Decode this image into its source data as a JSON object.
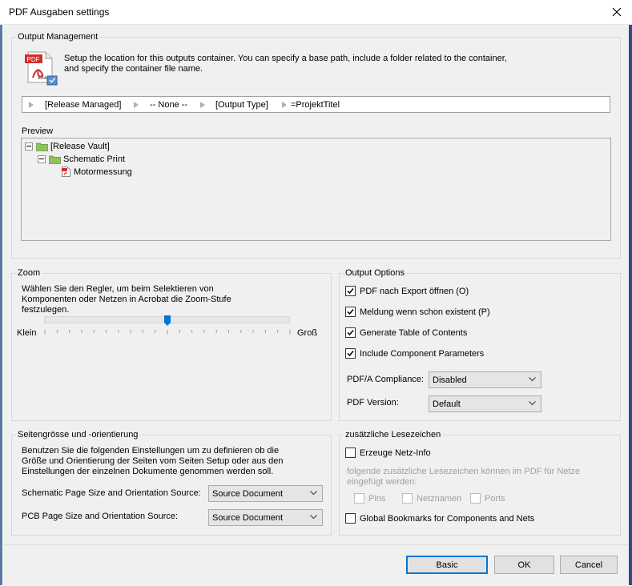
{
  "window": {
    "title": "PDF Ausgaben settings"
  },
  "output_management": {
    "title": "Output Management",
    "description_line1": "Setup the location for this outputs container. You can specify a base path, include a folder related to the container,",
    "description_line2": "and specify the container file name.",
    "path_segments": [
      "[Release Managed]",
      "-- None --",
      "[Output Type]",
      "=ProjektTitel"
    ],
    "preview_label": "Preview",
    "tree": [
      {
        "label": "[Release Vault]"
      },
      {
        "label": "Schematic Print"
      },
      {
        "label": "Motormessung"
      }
    ]
  },
  "zoom": {
    "title": "Zoom",
    "description_line1": "Wählen Sie den Regler, um beim Selektieren von",
    "description_line2": "Komponenten oder Netzen in Acrobat die Zoom-Stufe",
    "description_line3": "festzulegen.",
    "min_label": "Klein",
    "max_label": "Groß",
    "slider_fraction": 0.5
  },
  "output_options": {
    "title": "Output Options",
    "checkboxes": [
      {
        "label": "PDF nach Export öffnen (O)",
        "checked": true
      },
      {
        "label": "Meldung wenn schon existent (P)",
        "checked": true
      },
      {
        "label": "Generate Table of Contents",
        "checked": true
      },
      {
        "label": "Include Component Parameters",
        "checked": true
      }
    ],
    "pdfa_label": "PDF/A Compliance:",
    "pdfa_value": "Disabled",
    "version_label": "PDF Version:",
    "version_value": "Default"
  },
  "page_size": {
    "title": "Seitengrösse und -orientierung",
    "description_line1": "Benutzen Sie die folgenden Einstellungen um zu definieren ob die",
    "description_line2": "Größe und Orientierung der Seiten vom Seiten Setup oder aus den",
    "description_line3": "Einstellungen der einzelnen Dokumente genommen werden soll.",
    "schematic_label": "Schematic Page Size and Orientation Source:",
    "schematic_value": "Source Document",
    "pcb_label": "PCB Page Size and Orientation Source:",
    "pcb_value": "Source Document"
  },
  "bookmarks": {
    "title": "zusätzliche Lesezeichen",
    "netinfo_label": "Erzeuge Netz-Info",
    "hint_line1": "folgende zusätzliche Lesezeichen können im PDF für Netze",
    "hint_line2": "eingefügt werden:",
    "pins_label": "Pins",
    "netnames_label": "Netznamen",
    "ports_label": "Ports",
    "global_label": "Global Bookmarks for Components and Nets"
  },
  "buttons": {
    "basic": "Basic",
    "ok": "OK",
    "cancel": "Cancel"
  },
  "colors": {
    "accent": "#0078d7",
    "folder": "#8fc25a",
    "pdf_red": "#d12d2d"
  }
}
